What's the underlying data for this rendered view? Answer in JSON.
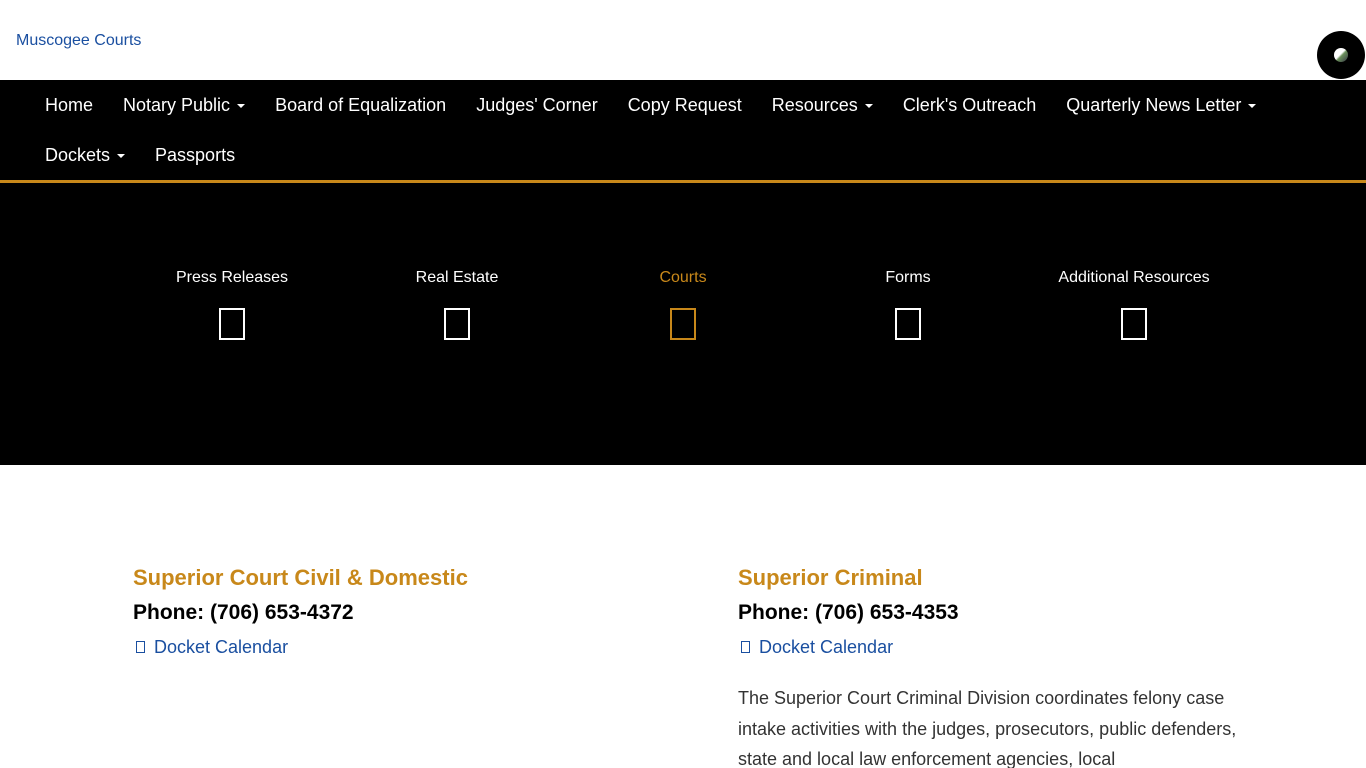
{
  "header": {
    "logo_alt": "Muscogee Courts",
    "logo_icon": "broken-image-icon",
    "account_icon": "globe-icon"
  },
  "nav": {
    "row1": [
      {
        "label": "Home",
        "dropdown": false
      },
      {
        "label": "Notary Public",
        "dropdown": true
      },
      {
        "label": "Board of Equalization",
        "dropdown": false
      },
      {
        "label": "Judges' Corner",
        "dropdown": false
      },
      {
        "label": "Copy Request",
        "dropdown": false
      },
      {
        "label": "Resources",
        "dropdown": true
      },
      {
        "label": "Clerk's Outreach",
        "dropdown": false
      },
      {
        "label": "Quarterly News Letter",
        "dropdown": true
      }
    ],
    "row2": [
      {
        "label": "Dockets",
        "dropdown": true
      },
      {
        "label": "Passports",
        "dropdown": false
      }
    ]
  },
  "hero": {
    "items": [
      {
        "label": "Press Releases",
        "active": false
      },
      {
        "label": "Real Estate",
        "active": false
      },
      {
        "label": "Courts",
        "active": true
      },
      {
        "label": "Forms",
        "active": false
      },
      {
        "label": "Additional Resources",
        "active": false
      }
    ]
  },
  "sections": {
    "left": {
      "title": "Superior Court Civil & Domestic",
      "phone": "Phone: (706) 653-4372",
      "link": "Docket Calendar"
    },
    "right": {
      "title": "Superior Criminal",
      "phone": "Phone: (706) 653-4353",
      "link": "Docket Calendar",
      "description": "The Superior Court Criminal Division coordinates felony case intake activities with the judges, prosecutors, public defenders, state and local law enforcement agencies, local"
    }
  },
  "colors": {
    "accent": "#c8881a",
    "link": "#1a4fa0",
    "nav_bg": "#000000"
  }
}
